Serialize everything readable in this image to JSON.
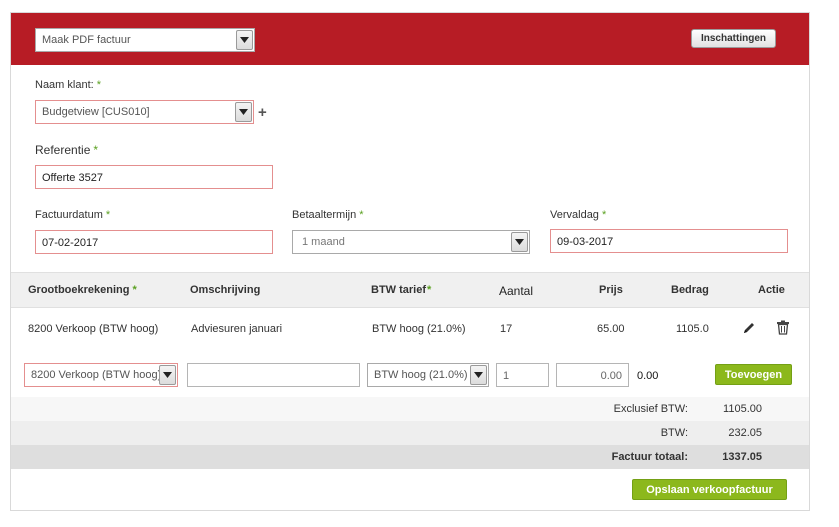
{
  "header": {
    "action_select": "Maak PDF factuur",
    "settings_button": "Inschattingen"
  },
  "form": {
    "client_label": "Naam klant:",
    "client_value": "Budgetview [CUS010]",
    "reference_label": "Referentie",
    "reference_value": "Offerte 3527",
    "invoice_date_label": "Factuurdatum",
    "invoice_date_value": "07-02-2017",
    "payment_term_label": "Betaaltermijn",
    "payment_term_value": "1 maand",
    "due_date_label": "Vervaldag",
    "due_date_value": "09-03-2017",
    "required_mark": "*"
  },
  "table": {
    "headers": {
      "ledger": "Grootboekrekening",
      "description": "Omschrijving",
      "vat": "BTW tarief",
      "quantity": "Aantal",
      "price": "Prijs",
      "amount": "Bedrag",
      "action": "Actie"
    },
    "rows": [
      {
        "ledger": "8200 Verkoop (BTW hoog)",
        "description": "Adviesuren januari",
        "vat": "BTW hoog (21.0%)",
        "quantity": "17",
        "price": "65.00",
        "amount": "1105.0"
      }
    ],
    "new_row": {
      "ledger": "8200 Verkoop (BTW hoog)",
      "description": "",
      "vat": "BTW hoog (21.0%)",
      "quantity": "1",
      "price": "0.00",
      "amount": "0.00",
      "add_button": "Toevoegen"
    }
  },
  "totals": {
    "excl_label": "Exclusief BTW:",
    "excl_value": "1105.00",
    "vat_label": "BTW:",
    "vat_value": "232.05",
    "total_label": "Factuur totaal:",
    "total_value": "1337.05"
  },
  "footer": {
    "save_button": "Opslaan verkoopfactuur"
  },
  "colors": {
    "header_red": "#b71c25",
    "accent_green": "#8cb81c",
    "required_green": "#5aa020",
    "error_border": "#e48f8f"
  },
  "icons": [
    "chevron-down-icon",
    "plus-icon",
    "pencil-icon",
    "trash-icon"
  ]
}
